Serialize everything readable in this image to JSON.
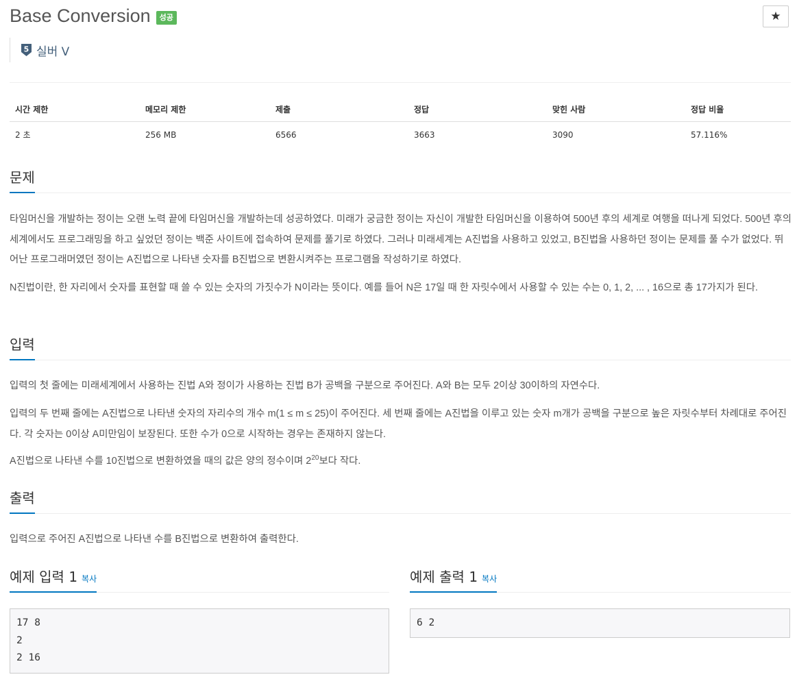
{
  "problem": {
    "title": "Base Conversion",
    "badge": "성공",
    "star": "★",
    "tier": {
      "number": "5",
      "label": "실버 V"
    }
  },
  "info_table": {
    "headers": [
      "시간 제한",
      "메모리 제한",
      "제출",
      "정답",
      "맞힌 사람",
      "정답 비율"
    ],
    "values": [
      "2 초",
      "256 MB",
      "6566",
      "3663",
      "3090",
      "57.116%"
    ]
  },
  "sections": {
    "problem": {
      "heading": "문제",
      "p1": "타임머신을 개발하는 정이는 오랜 노력 끝에 타임머신을 개발하는데 성공하였다. 미래가 궁금한 정이는 자신이 개발한 타임머신을 이용하여 500년 후의 세계로 여행을 떠나게 되었다. 500년 후의 세계에서도 프로그래밍을 하고 싶었던 정이는 백준 사이트에 접속하여 문제를 풀기로 하였다. 그러나 미래세계는 A진법을 사용하고 있었고, B진법을 사용하던 정이는 문제를 풀 수가 없었다. 뛰어난 프로그래머였던 정이는 A진법으로 나타낸 숫자를 B진법으로 변환시켜주는 프로그램을 작성하기로 하였다.",
      "p2": "N진법이란, 한 자리에서 숫자를 표현할 때 쓸 수 있는 숫자의 가짓수가 N이라는 뜻이다. 예를 들어 N은 17일 때 한 자릿수에서 사용할 수 있는 수는 0, 1, 2, ... , 16으로 총 17가지가 된다."
    },
    "input": {
      "heading": "입력",
      "p1": "입력의 첫 줄에는 미래세계에서 사용하는 진법 A와 정이가 사용하는 진법 B가 공백을 구분으로 주어진다. A와 B는 모두 2이상 30이하의 자연수다.",
      "p2": "입력의 두 번째 줄에는 A진법으로 나타낸 숫자의 자리수의 개수 m(1 ≤ m ≤ 25)이 주어진다. 세 번째 줄에는 A진법을 이루고 있는 숫자 m개가 공백을 구분으로 높은 자릿수부터 차례대로 주어진다. 각 숫자는 0이상 A미만임이 보장된다. 또한 수가 0으로 시작하는 경우는 존재하지 않는다.",
      "p3_before": "A진법으로 나타낸 수를 10진법으로 변환하였을 때의 값은 양의 정수이며 2",
      "p3_sup": "20",
      "p3_after": "보다 작다."
    },
    "output": {
      "heading": "출력",
      "p1": "입력으로 주어진 A진법으로 나타낸 수를 B진법으로 변환하여 출력한다."
    }
  },
  "samples": {
    "input": {
      "title": "예제 입력 1",
      "copy": "복사",
      "text": "17 8\n2\n2 16"
    },
    "output": {
      "title": "예제 출력 1",
      "copy": "복사",
      "text": "6 2"
    }
  }
}
